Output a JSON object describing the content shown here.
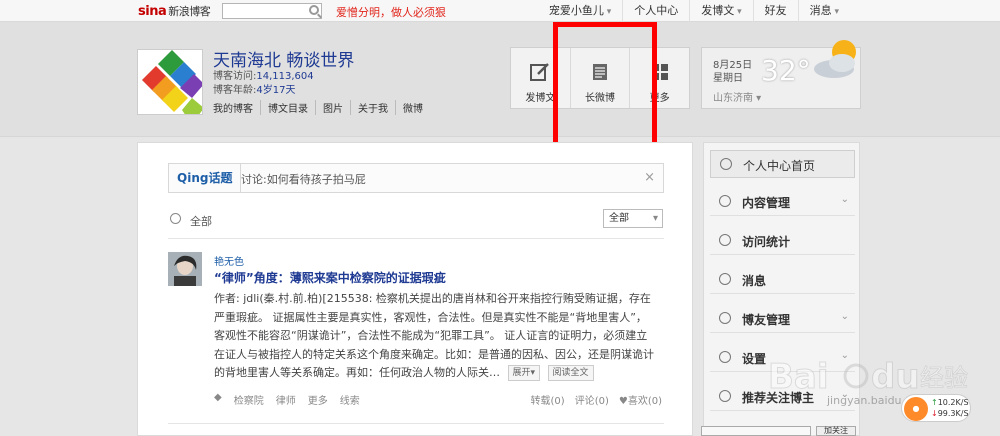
{
  "topbar": {
    "logo_main": "sina",
    "logo_rest": "新浪博客",
    "slogan": "爱憎分明，做人必须狠",
    "nav": [
      {
        "label": "宠爱小鱼儿",
        "caret": true
      },
      {
        "label": "个人中心",
        "caret": false
      },
      {
        "label": "发博文",
        "caret": true
      },
      {
        "label": "好友",
        "caret": false
      },
      {
        "label": "消息",
        "caret": true
      }
    ]
  },
  "blog": {
    "title": "天南海北 畅谈世界",
    "visits_label": "博客访问:",
    "visits": "14,113,604",
    "age_label": "博客年龄:",
    "age": "4岁17天",
    "links": [
      "我的博客",
      "博文目录",
      "图片",
      "关于我",
      "微博"
    ]
  },
  "toolbox": {
    "post": "发博文",
    "long_weibo": "长微博",
    "more": "更多"
  },
  "weather": {
    "date": "8月25日",
    "weekday": "星期日",
    "temp": "32°",
    "city": "山东济南"
  },
  "qing": {
    "tag": "Qing话题",
    "topic": "讨论:如何看待孩子拍马屁"
  },
  "filter": {
    "label": "全部",
    "select": "全部"
  },
  "post": {
    "author": "艳无色",
    "title": "“律师”角度：薄熙来案中检察院的证据瑕疵",
    "body": "作者: jdli(秦.村.前.柏)[215538: 检察机关提出的唐肖林和谷开来指控行贿受贿证据，存在严重瑕疵。 证据属性主要是真实性，客观性，合法性。但是真实性不能是“背地里害人”，客观性不能容忍“阴谋诡计”，合法性不能成为“犯罪工具”。 证人证言的证明力，必须建立在证人与被指控人的特定关系这个角度来确定。比如：是普通的因私、因公，还是阴谋诡计的背地里害人等关系确定。再如：任何政治人物的人际关…",
    "expand": "展开",
    "read_full": "阅读全文",
    "tags": [
      "检察院",
      "律师",
      "更多",
      "线索"
    ],
    "repost": "转载",
    "repost_count": "(0)",
    "comment": "评论",
    "comment_count": "(0)",
    "like": "喜欢",
    "like_count": "(0)"
  },
  "sidebar": {
    "items": [
      {
        "label": "个人中心首页",
        "chevron": false
      },
      {
        "label": "内容管理",
        "chevron": true
      },
      {
        "label": "访问统计",
        "chevron": false
      },
      {
        "label": "消息",
        "chevron": false
      },
      {
        "label": "博友管理",
        "chevron": true
      },
      {
        "label": "设置",
        "chevron": true
      },
      {
        "label": "推荐关注博主",
        "chevron": true
      }
    ],
    "add_follow": "加关注"
  },
  "network": {
    "up": "10.2K/S",
    "down": "99.3K/S"
  },
  "watermark": {
    "text": "jingyan.baidu.com"
  },
  "colors": {
    "highlight": "#ff0000",
    "link": "#1f3a93",
    "slogan": "#e1251b"
  }
}
